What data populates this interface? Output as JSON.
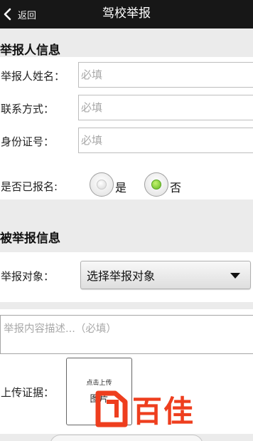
{
  "nav": {
    "back_label": "返回",
    "title": "驾校举报"
  },
  "reporter": {
    "section_title": "举报人信息",
    "name_label": "举报人姓名：",
    "name_placeholder": "必填",
    "contact_label": "联系方式：",
    "contact_placeholder": "必填",
    "id_label": "身份证号：",
    "id_placeholder": "必填",
    "registered_label": "是否已报名:",
    "options": [
      {
        "label": "是",
        "selected": false
      },
      {
        "label": "否",
        "selected": true
      }
    ]
  },
  "reported": {
    "section_title": "被举报信息",
    "target_label": "举报对象：",
    "target_value": "选择举报对象",
    "description_placeholder": "举报内容描述...（必填）",
    "evidence_label": "上传证据：",
    "upload_hint": "点击上传",
    "upload_text": "图片"
  },
  "watermark": {
    "text": "百佳"
  },
  "colors": {
    "nav_bg": "#171717",
    "radio_selected": "#63b823",
    "watermark": "#ee3e1e"
  }
}
